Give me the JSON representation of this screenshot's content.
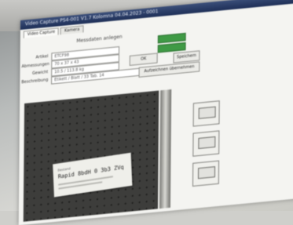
{
  "window": {
    "title": "Video Capture PS4-001 V1.7 Kolomna 04.04.2023 - 0001"
  },
  "tabs": [
    {
      "label": "Video Capture",
      "active": true
    },
    {
      "label": "Kamera",
      "active": false
    }
  ],
  "form": {
    "section_title": "Messdaten anlegen",
    "fields": [
      {
        "label": "Artikel",
        "value": "ETCF98"
      },
      {
        "label": "Abmessungen",
        "value": "70 x 37 x 43"
      },
      {
        "label": "Gewicht",
        "value": "10.5 / 113.8 kg"
      },
      {
        "label": "Beschreibung",
        "value": "Etikett / Blatt / 33 Tab. 14"
      }
    ],
    "ok_label": "OK",
    "save_label": "Speichern",
    "transfer_label": "Aufzeichnen übernehmen"
  },
  "camera": {
    "label_small_text": "Bestand",
    "label_code": "Rapid 8bdH 0 3b3 ZVq"
  },
  "colors": {
    "titlebar": "#1e2f57",
    "status_green": "#3f9a45",
    "reflection_red": "#b8452f"
  }
}
